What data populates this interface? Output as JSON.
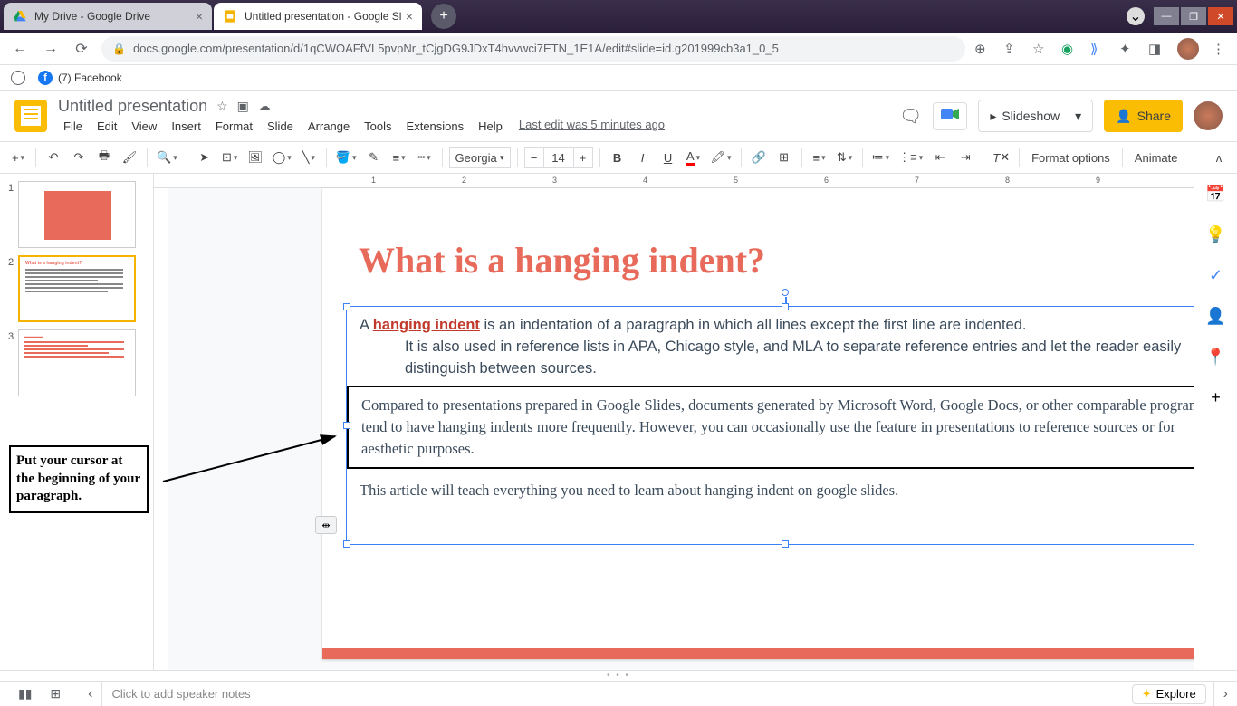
{
  "browser": {
    "tabs": [
      {
        "title": "My Drive - Google Drive"
      },
      {
        "title": "Untitled presentation - Google Sl"
      }
    ],
    "url": "docs.google.com/presentation/d/1qCWOAFfVL5pvpNr_tCjgDG9JDxT4hvvwci7ETN_1E1A/edit#slide=id.g201999cb3a1_0_5"
  },
  "bookmarks": {
    "fb": "(7) Facebook"
  },
  "header": {
    "title": "Untitled presentation",
    "last_edit": "Last edit was 5 minutes ago",
    "slideshow": "Slideshow",
    "share": "Share"
  },
  "menu": {
    "file": "File",
    "edit": "Edit",
    "view": "View",
    "insert": "Insert",
    "format": "Format",
    "slide": "Slide",
    "arrange": "Arrange",
    "tools": "Tools",
    "extensions": "Extensions",
    "help": "Help"
  },
  "toolbar": {
    "font": "Georgia",
    "font_size": "14",
    "format_options": "Format options",
    "animate": "Animate"
  },
  "slides": {
    "thumb2_title": "What is a hanging indent?"
  },
  "annotation": "Put your cursor at the beginning of your paragraph.",
  "slide": {
    "title": "What is a hanging indent?",
    "p1_a": "A ",
    "p1_link": "hanging indent",
    "p1_b": " is an indentation of a paragraph in which all lines except the first line are indented.",
    "p1_rest": "It is also used in reference lists in APA, Chicago style, and MLA to separate reference entries and let the reader easily distinguish between sources.",
    "p2": "Compared to presentations prepared in Google Slides, documents generated by Microsoft Word, Google Docs, or other comparable programs tend to have hanging indents more frequently. However, you can occasionally use the feature in presentations to reference sources or for aesthetic purposes.",
    "p3": "This article will teach everything you need to learn about hanging indent on google slides."
  },
  "bottom": {
    "notes_placeholder": "Click to add speaker notes",
    "explore": "Explore"
  }
}
